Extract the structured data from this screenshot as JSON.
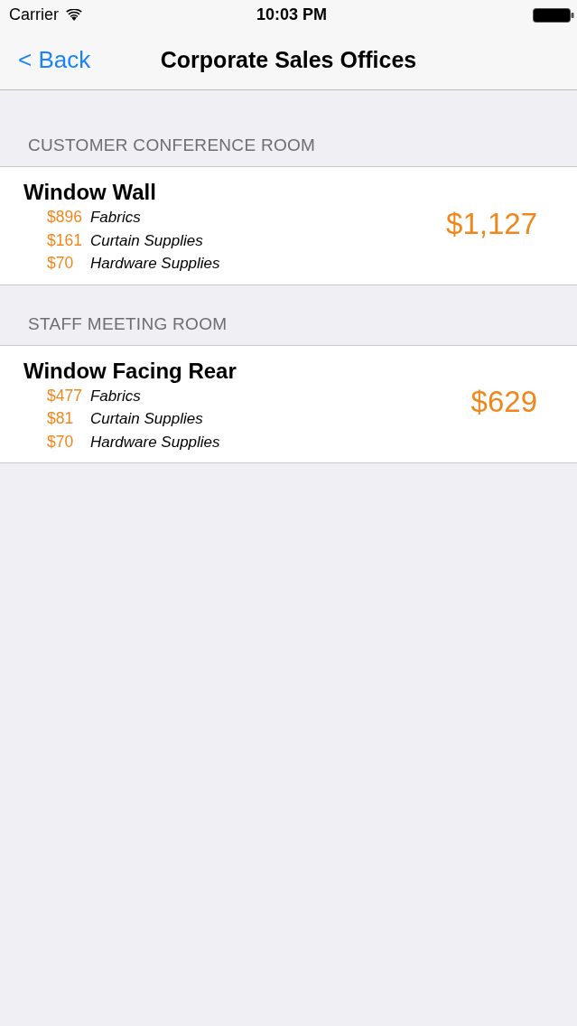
{
  "status_bar": {
    "carrier": "Carrier",
    "time": "10:03 PM"
  },
  "nav_bar": {
    "back": "< Back",
    "title": "Corporate Sales Offices"
  },
  "sections": [
    {
      "header": "CUSTOMER CONFERENCE ROOM",
      "items": [
        {
          "title": "Window Wall",
          "total": "$1,127",
          "lines": [
            {
              "amount": "$896",
              "label": "Fabrics"
            },
            {
              "amount": "$161",
              "label": "Curtain Supplies"
            },
            {
              "amount": "$70",
              "label": "Hardware Supplies"
            }
          ]
        }
      ]
    },
    {
      "header": "STAFF MEETING ROOM",
      "items": [
        {
          "title": "Window Facing Rear",
          "total": "$629",
          "lines": [
            {
              "amount": "$477",
              "label": "Fabrics"
            },
            {
              "amount": "$81",
              "label": "Curtain Supplies"
            },
            {
              "amount": "$70",
              "label": "Hardware Supplies"
            }
          ]
        }
      ]
    }
  ]
}
